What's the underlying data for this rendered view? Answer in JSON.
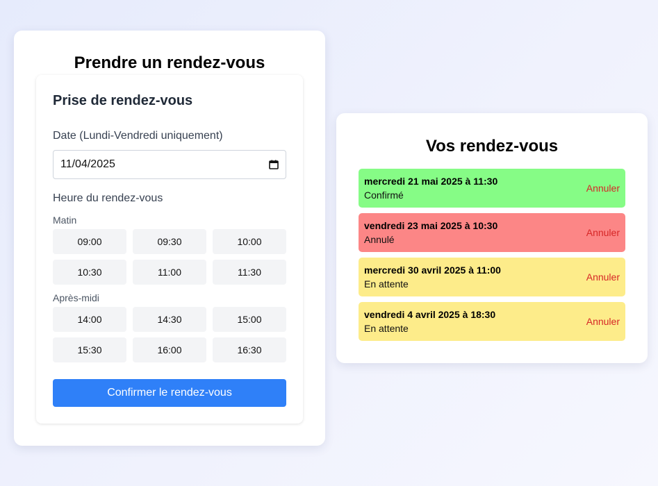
{
  "booking": {
    "title": "Prendre un rendez-vous",
    "form_title": "Prise de rendez-vous",
    "date_label": "Date (Lundi-Vendredi uniquement)",
    "date_value": "11/04/2025",
    "time_label": "Heure du rendez-vous",
    "morning_label": "Matin",
    "morning_slots": [
      "09:00",
      "09:30",
      "10:00",
      "10:30",
      "11:00",
      "11:30"
    ],
    "afternoon_label": "Après-midi",
    "afternoon_slots": [
      "14:00",
      "14:30",
      "15:00",
      "15:30",
      "16:00",
      "16:30"
    ],
    "confirm_label": "Confirmer le rendez-vous"
  },
  "appointments": {
    "title": "Vos rendez-vous",
    "cancel_label": "Annuler",
    "items": [
      {
        "date": "mercredi 21 mai 2025 à 11:30",
        "status": "Confirmé",
        "color": "#86fc86"
      },
      {
        "date": "vendredi 23 mai 2025 à 10:30",
        "status": "Annulé",
        "color": "#fc8686"
      },
      {
        "date": "mercredi 30 avril 2025 à 11:00",
        "status": "En attente",
        "color": "#fdec8a"
      },
      {
        "date": "vendredi 4 avril 2025 à 18:30",
        "status": "En attente",
        "color": "#fdec8a"
      }
    ]
  },
  "icons": {
    "date_picker": "calendar-icon"
  },
  "colors": {
    "primary": "#2f80f8",
    "cancel": "#d62626"
  }
}
